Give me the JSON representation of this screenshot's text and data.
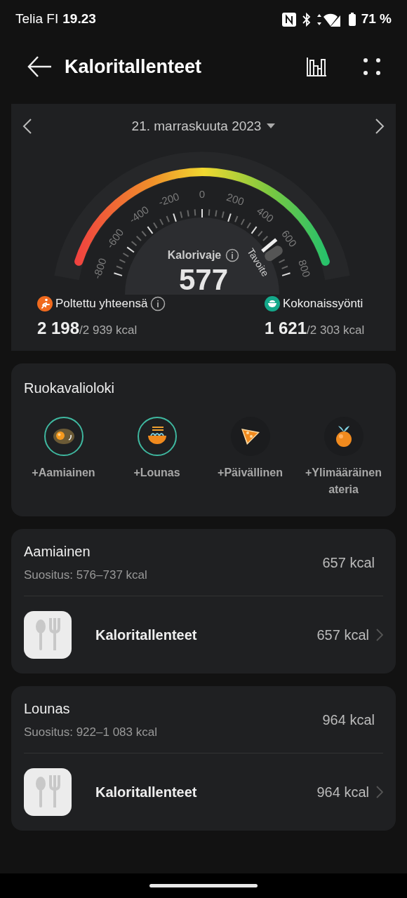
{
  "status_bar": {
    "carrier": "Telia FI",
    "time": "19.23",
    "battery": "71 %"
  },
  "header": {
    "title": "Kaloritallenteet"
  },
  "summary": {
    "date": "21. marraskuuta 2023",
    "gauge": {
      "scale_labels": [
        "-800",
        "-600",
        "-400",
        "-200",
        "0",
        "200",
        "400",
        "600",
        "800"
      ],
      "goal_label": "Tavoite",
      "title": "Kalorivaje",
      "value": "577"
    },
    "burned": {
      "label": "Poltettu yhteensä",
      "value": "2 198",
      "target": "/2 939 kcal"
    },
    "intake": {
      "label": "Kokonaissyönti",
      "value": "1 621",
      "target": "/2 303 kcal"
    }
  },
  "diet_log": {
    "title": "Ruokavalioloki",
    "meals": [
      {
        "kind": "egg",
        "label": "+Aamiainen",
        "logged": true
      },
      {
        "kind": "noodles",
        "label": "+Lounas",
        "logged": true
      },
      {
        "kind": "pizza",
        "label": "+Päivällinen",
        "logged": false
      },
      {
        "kind": "orange",
        "label": "+Ylimääräinen ateria",
        "logged": false
      }
    ]
  },
  "meal_cards": [
    {
      "title": "Aamiainen",
      "recommendation": "Suositus: 576–737 kcal",
      "total": "657 kcal",
      "entries": [
        {
          "name": "Kaloritallenteet",
          "kcal": "657 kcal"
        }
      ]
    },
    {
      "title": "Lounas",
      "recommendation": "Suositus: 922–1 083 kcal",
      "total": "964 kcal",
      "entries": [
        {
          "name": "Kaloritallenteet",
          "kcal": "964 kcal"
        }
      ]
    }
  ]
}
